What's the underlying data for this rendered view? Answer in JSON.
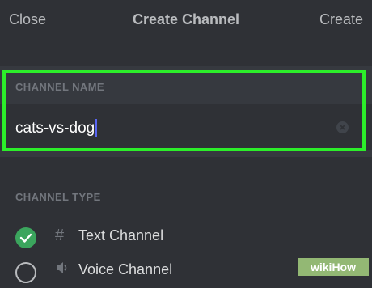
{
  "header": {
    "close_label": "Close",
    "title": "Create Channel",
    "create_label": "Create"
  },
  "channel_name": {
    "section_label": "CHANNEL NAME",
    "value": "cats-vs-dog"
  },
  "channel_type": {
    "section_label": "CHANNEL TYPE",
    "options": [
      {
        "icon": "#",
        "label": "Text Channel",
        "selected": true
      },
      {
        "icon": "speaker-icon",
        "label": "Voice Channel",
        "selected": false
      }
    ]
  },
  "watermark": {
    "text": "wikiHow"
  },
  "colors": {
    "highlight": "#2cee2a",
    "selected_radio": "#3ba55d",
    "caret": "#5865f2"
  }
}
